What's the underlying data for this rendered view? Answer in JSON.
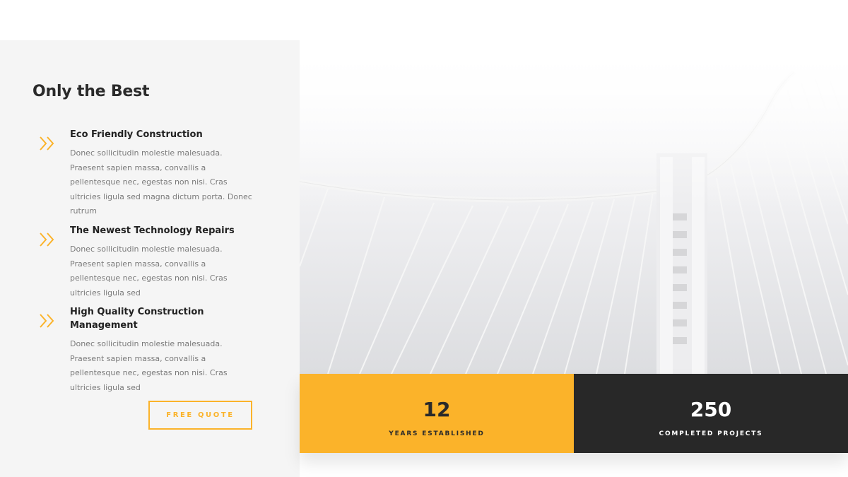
{
  "features_section": {
    "title": "Only the Best",
    "items": [
      {
        "title": "Eco Friendly Construction",
        "description": "Donec sollicitudin molestie malesuada. Praesent sapien massa, convallis a pellentesque nec, egestas non nisi. Cras ultricies ligula sed magna dictum porta. Donec rutrum",
        "icon": "double-chevron-right-icon"
      },
      {
        "title": "The Newest Technology Repairs",
        "description": "Donec sollicitudin molestie malesuada. Praesent sapien massa, convallis a pellentesque nec, egestas non nisi. Cras ultricies ligula sed",
        "icon": "double-chevron-right-icon"
      },
      {
        "title": "High Quality Construction Management",
        "description": "Donec sollicitudin molestie malesuada. Praesent sapien massa, convallis a pellentesque nec, egestas non nisi. Cras ultricies ligula sed",
        "icon": "double-chevron-right-icon"
      }
    ],
    "cta_label": "FREE QUOTE"
  },
  "stats": [
    {
      "value": "12",
      "label": "YEARS ESTABLISHED"
    },
    {
      "value": "250",
      "label": "COMPLETED PROJECTS"
    }
  ],
  "colors": {
    "accent": "#fbb32a",
    "dark": "#282828",
    "panel": "#f5f5f5",
    "heading": "#2a2a2a",
    "body_text": "#7a7a7a"
  }
}
